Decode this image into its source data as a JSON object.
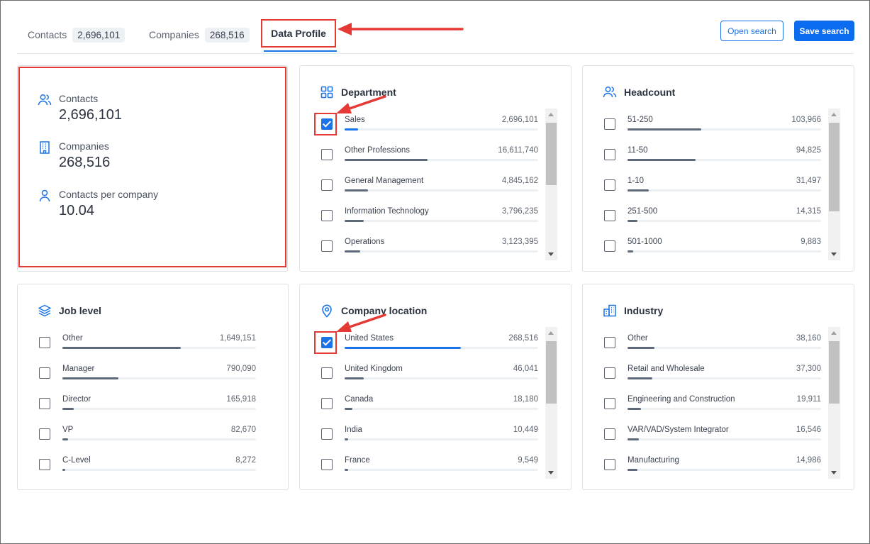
{
  "tabs": {
    "contacts": {
      "label": "Contacts",
      "count": "2,696,101"
    },
    "companies": {
      "label": "Companies",
      "count": "268,516"
    },
    "profile": {
      "label": "Data Profile"
    }
  },
  "actions": {
    "open_search": "Open search",
    "save_search": "Save search"
  },
  "summary": {
    "contacts_label": "Contacts",
    "contacts_value": "2,696,101",
    "companies_label": "Companies",
    "companies_value": "268,516",
    "per_company_label": "Contacts per company",
    "per_company_value": "10.04"
  },
  "colors": {
    "accent": "#1a73e8",
    "highlight": "#e53935",
    "bar": "#5e6a7a"
  },
  "department": {
    "title": "Department",
    "icon": "grid-icon",
    "items": [
      {
        "label": "Sales",
        "count": "2,696,101",
        "fill": 0.07,
        "checked": true
      },
      {
        "label": "Other Professions",
        "count": "16,611,740",
        "fill": 0.43,
        "checked": false
      },
      {
        "label": "General Management",
        "count": "4,845,162",
        "fill": 0.12,
        "checked": false
      },
      {
        "label": "Information Technology",
        "count": "3,796,235",
        "fill": 0.1,
        "checked": false
      },
      {
        "label": "Operations",
        "count": "3,123,395",
        "fill": 0.08,
        "checked": false
      }
    ]
  },
  "headcount": {
    "title": "Headcount",
    "icon": "users-icon",
    "items": [
      {
        "label": "51-250",
        "count": "103,966",
        "fill": 0.38,
        "checked": false
      },
      {
        "label": "11-50",
        "count": "94,825",
        "fill": 0.35,
        "checked": false
      },
      {
        "label": "1-10",
        "count": "31,497",
        "fill": 0.11,
        "checked": false
      },
      {
        "label": "251-500",
        "count": "14,315",
        "fill": 0.05,
        "checked": false
      },
      {
        "label": "501-1000",
        "count": "9,883",
        "fill": 0.03,
        "checked": false
      }
    ]
  },
  "job_level": {
    "title": "Job level",
    "icon": "layers-icon",
    "items": [
      {
        "label": "Other",
        "count": "1,649,151",
        "fill": 0.61,
        "checked": false
      },
      {
        "label": "Manager",
        "count": "790,090",
        "fill": 0.29,
        "checked": false
      },
      {
        "label": "Director",
        "count": "165,918",
        "fill": 0.06,
        "checked": false
      },
      {
        "label": "VP",
        "count": "82,670",
        "fill": 0.03,
        "checked": false
      },
      {
        "label": "C-Level",
        "count": "8,272",
        "fill": 0.005,
        "checked": false
      }
    ]
  },
  "company_location": {
    "title": "Company location",
    "icon": "location-pin-icon",
    "items": [
      {
        "label": "United States",
        "count": "268,516",
        "fill": 0.6,
        "checked": true
      },
      {
        "label": "United Kingdom",
        "count": "46,041",
        "fill": 0.1,
        "checked": false
      },
      {
        "label": "Canada",
        "count": "18,180",
        "fill": 0.04,
        "checked": false
      },
      {
        "label": "India",
        "count": "10,449",
        "fill": 0.02,
        "checked": false
      },
      {
        "label": "France",
        "count": "9,549",
        "fill": 0.02,
        "checked": false
      }
    ]
  },
  "industry": {
    "title": "Industry",
    "icon": "buildings-icon",
    "items": [
      {
        "label": "Other",
        "count": "38,160",
        "fill": 0.14,
        "checked": false
      },
      {
        "label": "Retail and Wholesale",
        "count": "37,300",
        "fill": 0.13,
        "checked": false
      },
      {
        "label": "Engineering and Construction",
        "count": "19,911",
        "fill": 0.07,
        "checked": false
      },
      {
        "label": "VAR/VAD/System Integrator",
        "count": "16,546",
        "fill": 0.06,
        "checked": false
      },
      {
        "label": "Manufacturing",
        "count": "14,986",
        "fill": 0.05,
        "checked": false
      }
    ]
  }
}
